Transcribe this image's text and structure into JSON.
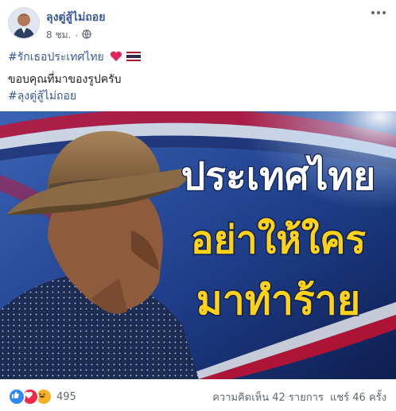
{
  "author": {
    "name": "ลุงตู่สู้ไม่ถอย"
  },
  "meta": {
    "time": "8 ชม.",
    "separator": "·"
  },
  "post": {
    "hashtag_line": "#รักเธอประเทศไทย",
    "body_line": "ขอบคุณที่มาของรูปครับ",
    "hashtag_line_2": "#ลุงตู่สู้ไม่ถอย"
  },
  "image": {
    "headline_1": "ประเทศไทย",
    "headline_2": "อย่าให้ใคร",
    "headline_3": "มาทำร้าย"
  },
  "footer": {
    "reaction_count": "495",
    "comments": "ความคิดเห็น 42 รายการ",
    "shares": "แชร์ 46 ครั้ง"
  },
  "colors": {
    "link": "#385898",
    "headline_white": "#ffffff",
    "headline_yellow": "#ffd21a",
    "like": "#2d88ff",
    "love": "#f0284a",
    "haha": "#f7b125"
  }
}
